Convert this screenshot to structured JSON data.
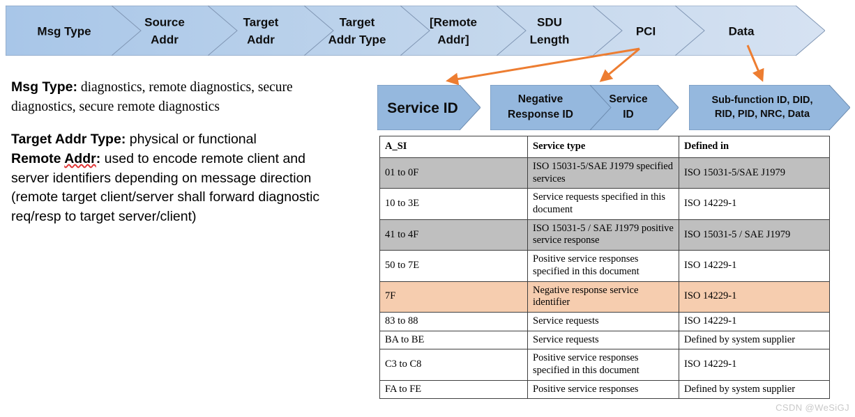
{
  "top_ribbon": {
    "segments": [
      {
        "label": "Msg Type",
        "lines": [
          "Msg Type"
        ]
      },
      {
        "label": "Source Addr",
        "lines": [
          "Source",
          "Addr"
        ]
      },
      {
        "label": "Target Addr",
        "lines": [
          "Target",
          "Addr"
        ]
      },
      {
        "label": "Target Addr Type",
        "lines": [
          "Target",
          "Addr Type"
        ]
      },
      {
        "label": "[Remote Addr]",
        "lines": [
          "[Remote",
          "Addr]"
        ]
      },
      {
        "label": "SDU Length",
        "lines": [
          "SDU",
          "Length"
        ]
      },
      {
        "label": "PCI",
        "lines": [
          "PCI"
        ]
      },
      {
        "label": "Data",
        "lines": [
          "Data"
        ]
      }
    ],
    "fill_start": "#a8c6e8",
    "fill_end": "#d3e0f0",
    "stroke": "#8096b4"
  },
  "notes": {
    "paragraphs": [
      {
        "key": "Msg Type:",
        "body": " diagnostics, remote diagnostics, secure diagnostics, secure remote diagnostics",
        "body_style": "serif"
      },
      {
        "key": "Target Addr Type:",
        "body": " physical or functional",
        "body_style": "sans",
        "key2_pre": "Remote ",
        "key2_misspelled": "Addr",
        "key2_post": ":",
        "body2": " used to encode remote client and server identifiers depending on message direction (remote target client/server shall forward diagnostic req/resp to target server/client)"
      }
    ]
  },
  "mid_chevrons": {
    "fill": "#95b8de",
    "stroke": "#6d8cb0",
    "service_id": {
      "lines": [
        "Service ID"
      ]
    },
    "negative_response_id": {
      "lines": [
        "Negative",
        "Response ID"
      ]
    },
    "service_id_2": {
      "lines": [
        "Service",
        "ID"
      ]
    },
    "sub_function": {
      "lines": [
        "Sub-function ID, DID,",
        "RID, PID, NRC, Data"
      ]
    }
  },
  "arrows": {
    "color": "#ed7d31",
    "count": 3
  },
  "table": {
    "columns": [
      "A_SI",
      "Service type",
      "Defined in"
    ],
    "rows": [
      {
        "shade": "gray",
        "a_si": "01 to 0F",
        "service_type": "ISO 15031-5/SAE J1979 specified services",
        "defined_in": "ISO 15031-5/SAE J1979"
      },
      {
        "shade": "white",
        "a_si": "10 to 3E",
        "service_type": "Service requests specified in this document",
        "defined_in": "ISO 14229-1"
      },
      {
        "shade": "gray",
        "a_si": "41 to 4F",
        "service_type": "ISO 15031-5 / SAE J1979 positive service response",
        "defined_in": "ISO 15031-5 / SAE J1979"
      },
      {
        "shade": "white",
        "a_si": "50 to 7E",
        "service_type": "Positive service responses specified in this document",
        "defined_in": "ISO 14229-1"
      },
      {
        "shade": "peach",
        "a_si": "7F",
        "service_type": "Negative response service identifier",
        "defined_in": "ISO 14229-1"
      },
      {
        "shade": "white",
        "a_si": "83 to 88",
        "service_type": "Service requests",
        "defined_in": "ISO 14229-1"
      },
      {
        "shade": "white",
        "a_si": "BA to BE",
        "service_type": "Service requests",
        "defined_in": "Defined by system supplier"
      },
      {
        "shade": "white",
        "a_si": "C3 to C8",
        "service_type": "Positive service responses specified in this document",
        "defined_in": "ISO 14229-1"
      },
      {
        "shade": "white",
        "a_si": "FA to FE",
        "service_type": "Positive service responses",
        "defined_in": "Defined by system supplier"
      }
    ],
    "shade_colors": {
      "gray": "#bfbfbf",
      "peach": "#f6cdaf",
      "white": "#ffffff"
    }
  },
  "watermark": {
    "text": "CSDN @WeSiGJ"
  }
}
